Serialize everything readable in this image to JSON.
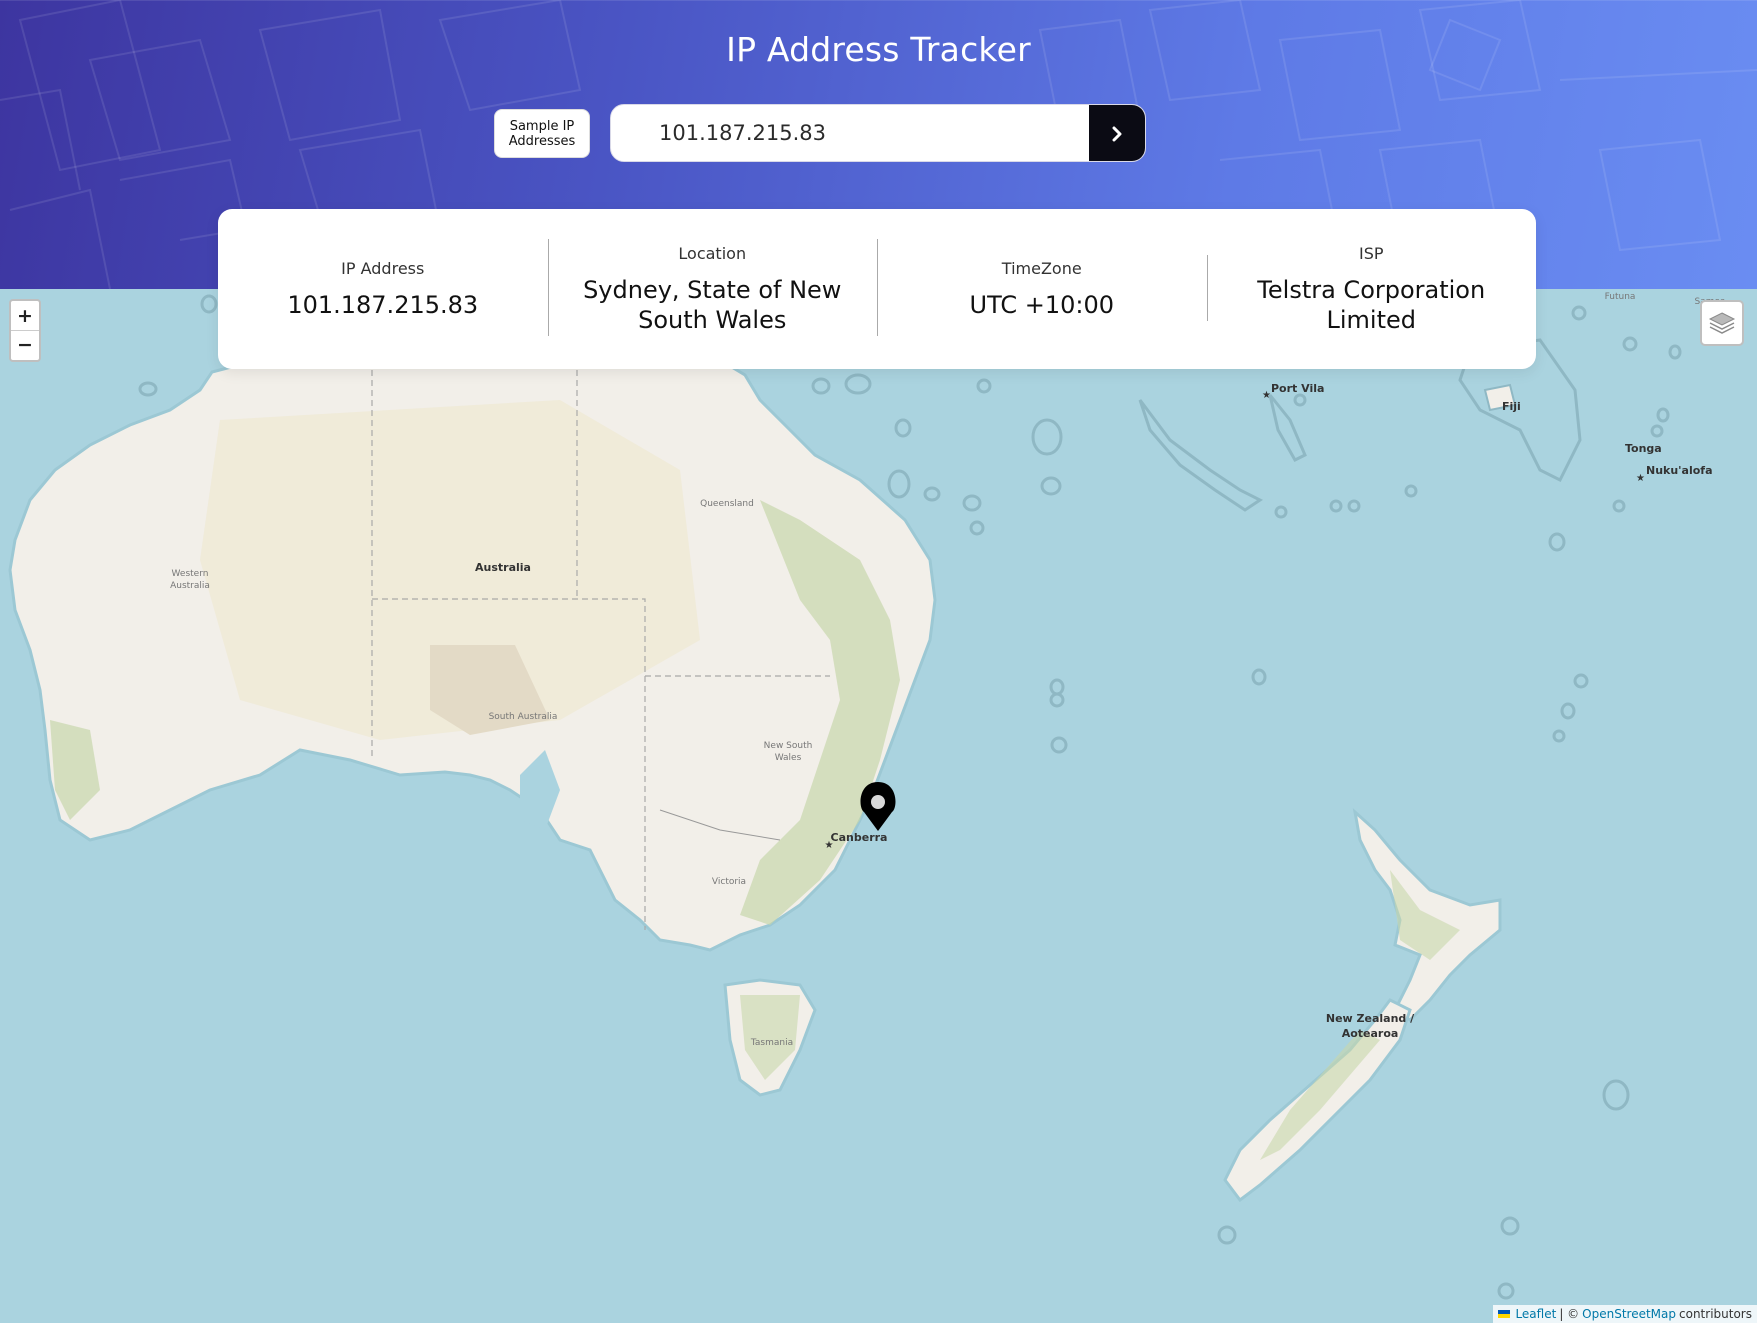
{
  "header": {
    "title": "IP Address Tracker",
    "sample_button_label": "Sample IP Addresses",
    "search_value": "101.187.215.83"
  },
  "info": {
    "ip_label": "IP Address",
    "ip_value": "101.187.215.83",
    "location_label": "Location",
    "location_value": "Sydney, State of New South Wales",
    "timezone_label": "TimeZone",
    "timezone_value": "UTC +10:00",
    "isp_label": "ISP",
    "isp_value": "Telstra Corporation Limited"
  },
  "map": {
    "zoom_in": "+",
    "zoom_out": "−",
    "labels": {
      "australia": "Australia",
      "western_australia_1": "Western",
      "western_australia_2": "Australia",
      "queensland": "Queensland",
      "south_australia": "South Australia",
      "nsw_1": "New South",
      "nsw_2": "Wales",
      "victoria": "Victoria",
      "tasmania": "Tasmania",
      "canberra": "Canberra",
      "port_vila": "Port Vila",
      "fiji": "Fiji",
      "tonga": "Tonga",
      "nukualofa": "Nuku'alofa",
      "nz_1": "New Zealand /",
      "nz_2": "Aotearoa",
      "futuna": "Futuna",
      "samoa": "Samoa"
    },
    "attribution": {
      "leaflet": "Leaflet",
      "separator": "| ©",
      "osm": "OpenStreetMap",
      "contributors": "contributors"
    }
  },
  "colors": {
    "sea": "#aad3df",
    "land": "#f2efe9",
    "header_start": "#3d35a0",
    "header_end": "#6a8df2",
    "search_button": "#0b0b14"
  }
}
